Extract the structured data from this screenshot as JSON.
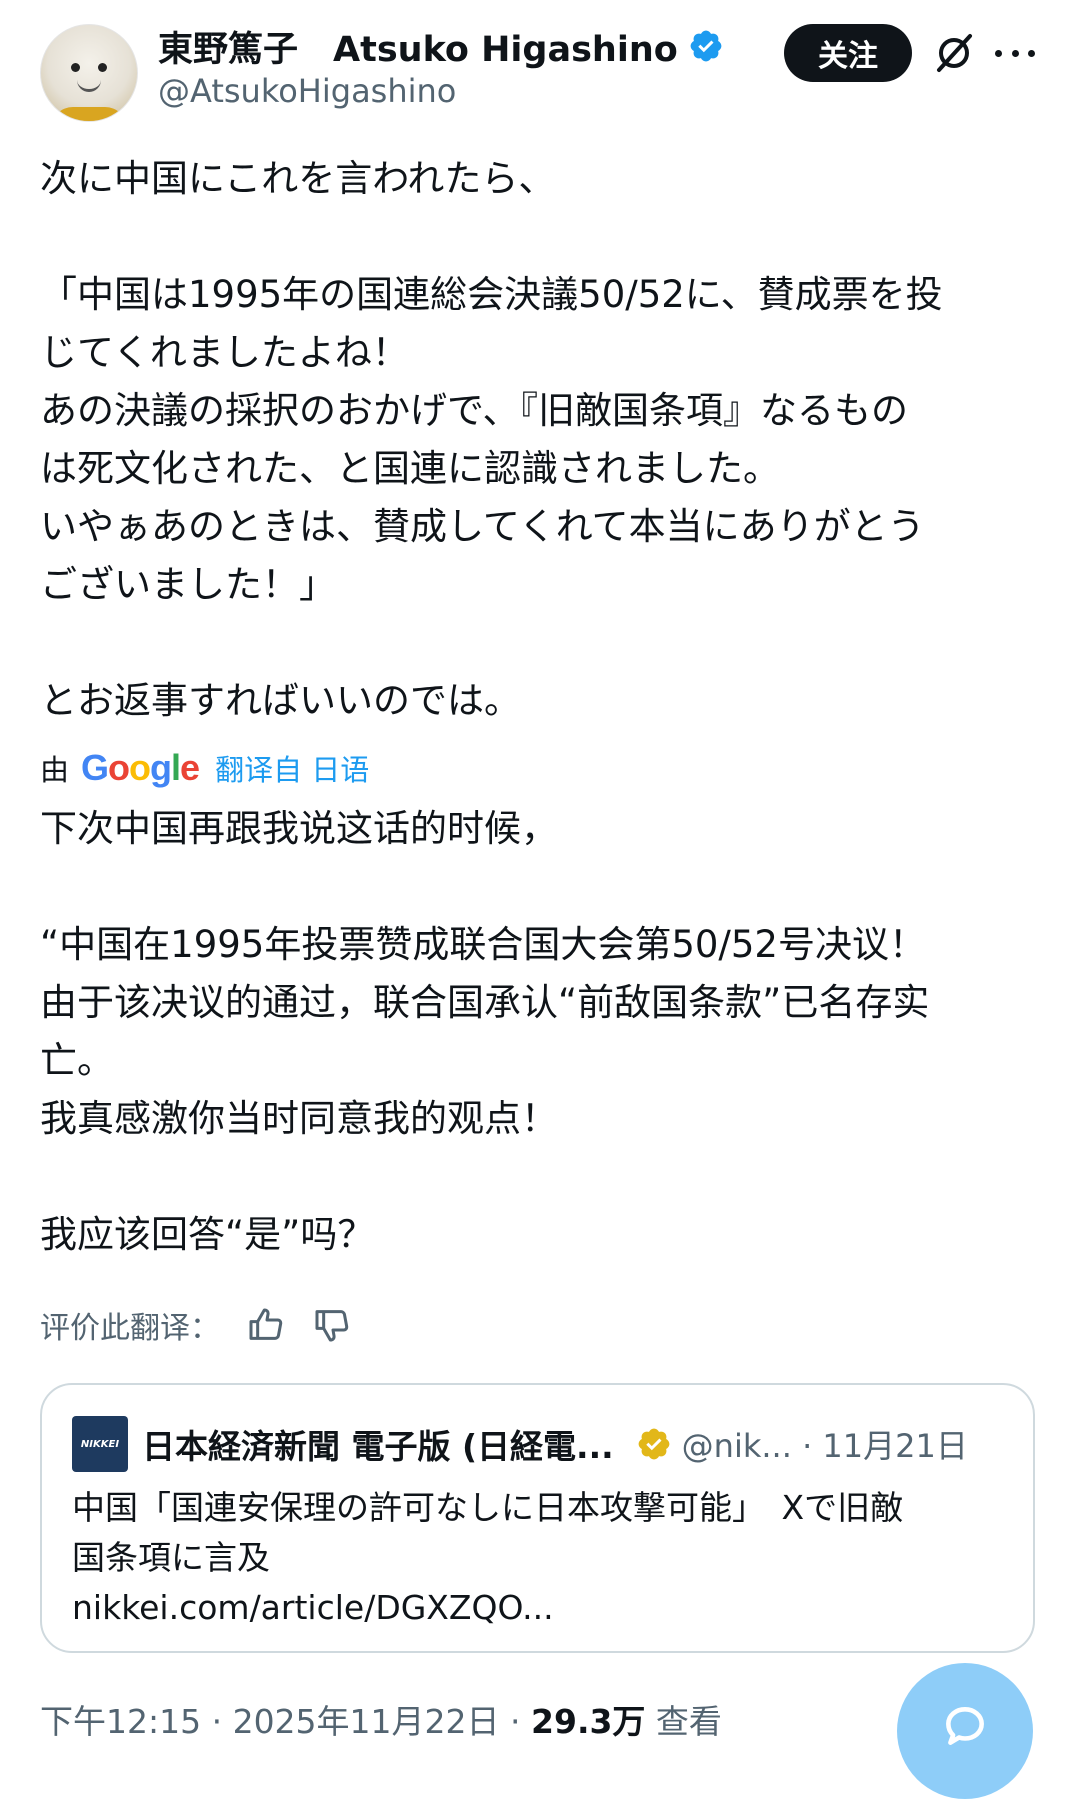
{
  "author": {
    "display_name": "東野篤子　Atsuko Higashino",
    "handle": "@AtsukoHigashino",
    "avatar_icon": "avatar-photo",
    "verified_icon": "verified-badge-icon",
    "verified_color": "#1d9bf0"
  },
  "actions": {
    "follow_label": "关注",
    "grok_icon": "grok-icon",
    "more_icon": "more-icon"
  },
  "tweet": {
    "lines": [
      "次に中国にこれを言われたら、",
      "",
      "「中国は1995年の国連総会決議50/52に、賛成票を投",
      "じてくれましたよね！",
      "あの決議の採択のおかげで、『旧敵国条項』なるもの",
      "は死文化された、と国連に認識されました。",
      "いやぁあのときは、賛成してくれて本当にありがとう",
      "ございました！」",
      "",
      "とお返事すればいいのでは。"
    ]
  },
  "translation": {
    "by_label": "由",
    "provider": "Google",
    "link_label": "翻译自 日语",
    "link_color": "#1d9bf0",
    "lines": [
      "下次中国再跟我说这话的时候，",
      "",
      "“中国在1995年投票赞成联合国大会第50/52号决议！",
      "由于该决议的通过，联合国承认“前敌国条款”已名存实",
      "亡。",
      "我真感激你当时同意我的观点！",
      "",
      "我应该回答“是”吗？"
    ],
    "rate_label": "评价此翻译：",
    "thumbs_up_icon": "thumbs-up-icon",
    "thumbs_down_icon": "thumbs-down-icon"
  },
  "quoted_card": {
    "logo_text": "NIKKEI",
    "source_name": "日本経済新聞 電子版 (日経電...",
    "badge_icon": "gold-verified-badge-icon",
    "badge_color": "#e2b719",
    "handle_date": "@nik... · 11月21日",
    "lines": [
      "中国「国連安保理の許可なしに日本攻撃可能」　Xで旧敵",
      "国条項に言及",
      "nikkei.com/article/DGXZQO..."
    ]
  },
  "footer": {
    "time_date": "下午12:15 · 2025年11月22日 · ",
    "views_count": "29.3万",
    "views_label": " 查看"
  },
  "fab": {
    "icon": "compose-reply-icon",
    "color": "#8ecdf8"
  }
}
